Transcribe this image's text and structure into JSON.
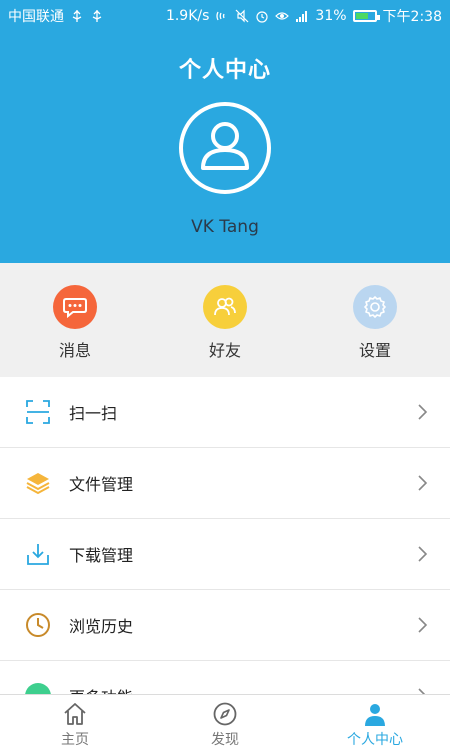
{
  "status_bar": {
    "carrier": "中国联通",
    "speed": "1.9K/s",
    "battery_percent": "31%",
    "time": "下午2:38"
  },
  "header": {
    "title": "个人中心",
    "username": "VK Tang"
  },
  "quick_actions": [
    {
      "label": "消息",
      "icon": "chat-bubble-icon",
      "color": "#f5663b"
    },
    {
      "label": "好友",
      "icon": "friends-icon",
      "color": "#f7cf3b"
    },
    {
      "label": "设置",
      "icon": "gear-icon",
      "color": "#bad6f0"
    }
  ],
  "menu": [
    {
      "label": "扫一扫",
      "icon": "scan-icon"
    },
    {
      "label": "文件管理",
      "icon": "layers-icon"
    },
    {
      "label": "下载管理",
      "icon": "download-icon"
    },
    {
      "label": "浏览历史",
      "icon": "clock-icon"
    },
    {
      "label": "更多功能",
      "icon": "more-icon"
    }
  ],
  "tabs": [
    {
      "label": "主页",
      "icon": "home-icon",
      "active": false
    },
    {
      "label": "发现",
      "icon": "compass-icon",
      "active": false
    },
    {
      "label": "个人中心",
      "icon": "person-icon",
      "active": true
    }
  ],
  "colors": {
    "primary": "#2aa8e0",
    "inactive_tab": "#777777",
    "active_tab": "#2aa8e0"
  }
}
